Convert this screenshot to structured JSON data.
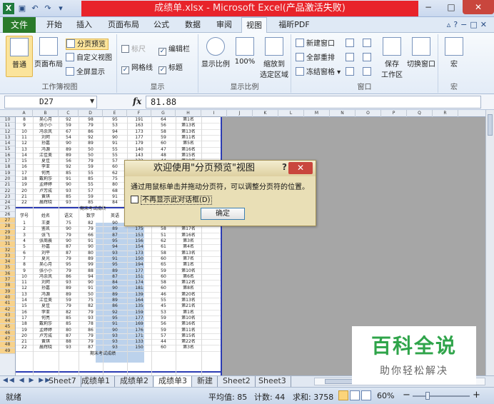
{
  "window": {
    "title_prefix": "成绩单.xlsx - Microsoft Excel(",
    "title_status": "产品激活失败",
    "title_suffix": ")",
    "minimize": "−",
    "maximize": "□",
    "close": "✕"
  },
  "menu": {
    "file": "文件",
    "tabs": [
      "开始",
      "插入",
      "页面布局",
      "公式",
      "数据",
      "审阅",
      "视图",
      "福昕PDF"
    ],
    "active_tab": "视图"
  },
  "ribbon": {
    "workbook_views": {
      "normal": "普通",
      "page_layout": "页面布局",
      "page_break_preview": "分页预览",
      "custom_views": "自定义视图",
      "full_screen": "全屏显示",
      "label": "工作簿视图"
    },
    "show": {
      "ruler": "标尺",
      "gridlines": "网格线",
      "formula_bar": "编辑栏",
      "headings": "标题",
      "label": "显示"
    },
    "zoom": {
      "zoom": "显示比例",
      "hundred": "100%",
      "zoom_to_selection_1": "缩放到",
      "zoom_to_selection_2": "选定区域",
      "label": "显示比例"
    },
    "window": {
      "new_window": "新建窗口",
      "arrange_all": "全部重排",
      "freeze_panes": "冻结窗格",
      "save_workspace_1": "保存",
      "save_workspace_2": "工作区",
      "switch_windows": "切换窗口",
      "label": "窗口"
    },
    "macros": {
      "macros": "宏",
      "label": "宏"
    }
  },
  "formula_bar": {
    "cell_ref": "D27",
    "fx": "fx",
    "value": "81.88"
  },
  "columns": [
    "A",
    "B",
    "C",
    "D",
    "E",
    "F",
    "G",
    "H",
    "I",
    "J",
    "K",
    "L",
    "M",
    "N",
    "O",
    "P",
    "Q",
    "R"
  ],
  "rows_top": [
    "10",
    "11",
    "12",
    "13",
    "14",
    "15",
    "16",
    "17",
    "18",
    "19",
    "20",
    "21",
    "22",
    "23",
    "24",
    "25",
    "26"
  ],
  "rows_bottom": [
    "27",
    "28",
    "29",
    "30",
    "31",
    "32",
    "33",
    "34",
    "35",
    "36",
    "37",
    "38",
    "39",
    "40",
    "41",
    "42",
    "43",
    "44",
    "45",
    "46",
    "47",
    "48",
    "49"
  ],
  "table": {
    "footer_title": "期末考试成绩",
    "headers": [
      "学号",
      "姓名",
      "语文",
      "数学",
      "英语"
    ],
    "top_rows": [
      [
        "8",
        "吴心月",
        "92",
        "98",
        "95",
        "191",
        "64",
        "第1名"
      ],
      [
        "9",
        "张小小",
        "59",
        "79",
        "53",
        "163",
        "56",
        "第13名"
      ],
      [
        "10",
        "冯余凤",
        "67",
        "86",
        "94",
        "173",
        "58",
        "第13名"
      ],
      [
        "11",
        "刘珂",
        "54",
        "92",
        "90",
        "177",
        "59",
        "第11名"
      ],
      [
        "12",
        "孙嘉",
        "90",
        "89",
        "91",
        "179",
        "60",
        "第5名"
      ],
      [
        "13",
        "冯源",
        "89",
        "50",
        "55",
        "140",
        "47",
        "第16名"
      ],
      [
        "14",
        "江佳美",
        "89",
        "50",
        "55",
        "143",
        "48",
        "第15名"
      ],
      [
        "15",
        "夏佳",
        "56",
        "79",
        "57",
        "132",
        "44",
        "第19名"
      ],
      [
        "16",
        "李亚",
        "92",
        "59",
        "60",
        "150",
        "50",
        "第18名"
      ],
      [
        "17",
        "何亮",
        "85",
        "55",
        "62",
        "147",
        "49",
        "第17名"
      ],
      [
        "18",
        "戴莉莎",
        "91",
        "85",
        "75",
        "172",
        "57",
        "第9名"
      ],
      [
        "19",
        "孟婷婷",
        "90",
        "55",
        "80",
        "145",
        "48",
        "第14名"
      ],
      [
        "20",
        "卢芳成",
        "93",
        "57",
        "68",
        "162",
        "54",
        "第12名"
      ],
      [
        "21",
        "黄琪",
        "85",
        "59",
        "91",
        "150",
        "50",
        "第17名"
      ],
      [
        "22",
        "晨辉晓",
        "93",
        "85",
        "84",
        "177",
        "59",
        "第11名"
      ]
    ],
    "bottom_rows": [
      [
        "1",
        "王婆",
        "75",
        "82",
        "90",
        "172",
        "57",
        "第14名"
      ],
      [
        "2",
        "鉴凯",
        "90",
        "79",
        "89",
        "175",
        "58",
        "第17名"
      ],
      [
        "3",
        "张飞",
        "79",
        "66",
        "87",
        "153",
        "51",
        "第16名"
      ],
      [
        "4",
        "张周晨",
        "90",
        "91",
        "95",
        "156",
        "62",
        "第3名"
      ],
      [
        "5",
        "孙嘉",
        "87",
        "90",
        "94",
        "154",
        "61",
        "第4名"
      ],
      [
        "6",
        "刘平",
        "87",
        "80",
        "93",
        "173",
        "58",
        "第13名"
      ],
      [
        "7",
        "夏光",
        "79",
        "89",
        "91",
        "150",
        "60",
        "第7名"
      ],
      [
        "8",
        "吴心月",
        "95",
        "99",
        "95",
        "194",
        "65",
        "第1名"
      ],
      [
        "9",
        "张小小",
        "79",
        "88",
        "89",
        "177",
        "59",
        "第10名"
      ],
      [
        "10",
        "冯余凤",
        "86",
        "94",
        "87",
        "151",
        "60",
        "第6名"
      ],
      [
        "11",
        "刘珂",
        "93",
        "90",
        "84",
        "174",
        "58",
        "第12名"
      ],
      [
        "12",
        "孙嘉",
        "89",
        "91",
        "90",
        "181",
        "60",
        "第8名"
      ],
      [
        "13",
        "冯源",
        "89",
        "50",
        "89",
        "139",
        "46",
        "第20名"
      ],
      [
        "14",
        "江佳美",
        "59",
        "75",
        "89",
        "164",
        "55",
        "第13名"
      ],
      [
        "15",
        "夏佳",
        "79",
        "82",
        "86",
        "135",
        "45",
        "第21名"
      ],
      [
        "16",
        "李亚",
        "82",
        "79",
        "92",
        "159",
        "53",
        "第1名"
      ],
      [
        "17",
        "何亮",
        "85",
        "93",
        "95",
        "177",
        "59",
        "第10名"
      ],
      [
        "18",
        "戴莉莎",
        "85",
        "78",
        "91",
        "169",
        "56",
        "第16名"
      ],
      [
        "19",
        "孟婷婷",
        "80",
        "86",
        "90",
        "176",
        "59",
        "第11名"
      ],
      [
        "20",
        "卢芳成",
        "87",
        "79",
        "93",
        "171",
        "57",
        "第15名"
      ],
      [
        "21",
        "黄琪",
        "88",
        "79",
        "93",
        "133",
        "44",
        "第22名"
      ],
      [
        "22",
        "晨辉晓",
        "93",
        "87",
        "93",
        "150",
        "60",
        "第3名"
      ]
    ]
  },
  "dialog": {
    "title": "欢迎使用\"分页预览\"视图",
    "help": "?",
    "close": "✕",
    "message": "通过用鼠标单击并拖动分页符，可以调整分页符的位置。",
    "checkbox_label": "不再显示此对话框(D)",
    "ok": "确定"
  },
  "sheets": {
    "nav": "◀◀ ◀ ▶ ▶▶",
    "tabs": [
      "Sheet7",
      "成绩单1",
      "成绩单2",
      "成绩单3",
      "新建",
      "Sheet2",
      "Sheet3"
    ],
    "active": "成绩单3"
  },
  "status": {
    "mode": "就绪",
    "average": "平均值: 85",
    "count": "计数: 44",
    "sum": "求和: 3758",
    "zoom": "60%",
    "zoom_minus": "−",
    "zoom_plus": "+"
  },
  "watermark": {
    "main": "百科全说",
    "sub": "助你轻松解决"
  }
}
